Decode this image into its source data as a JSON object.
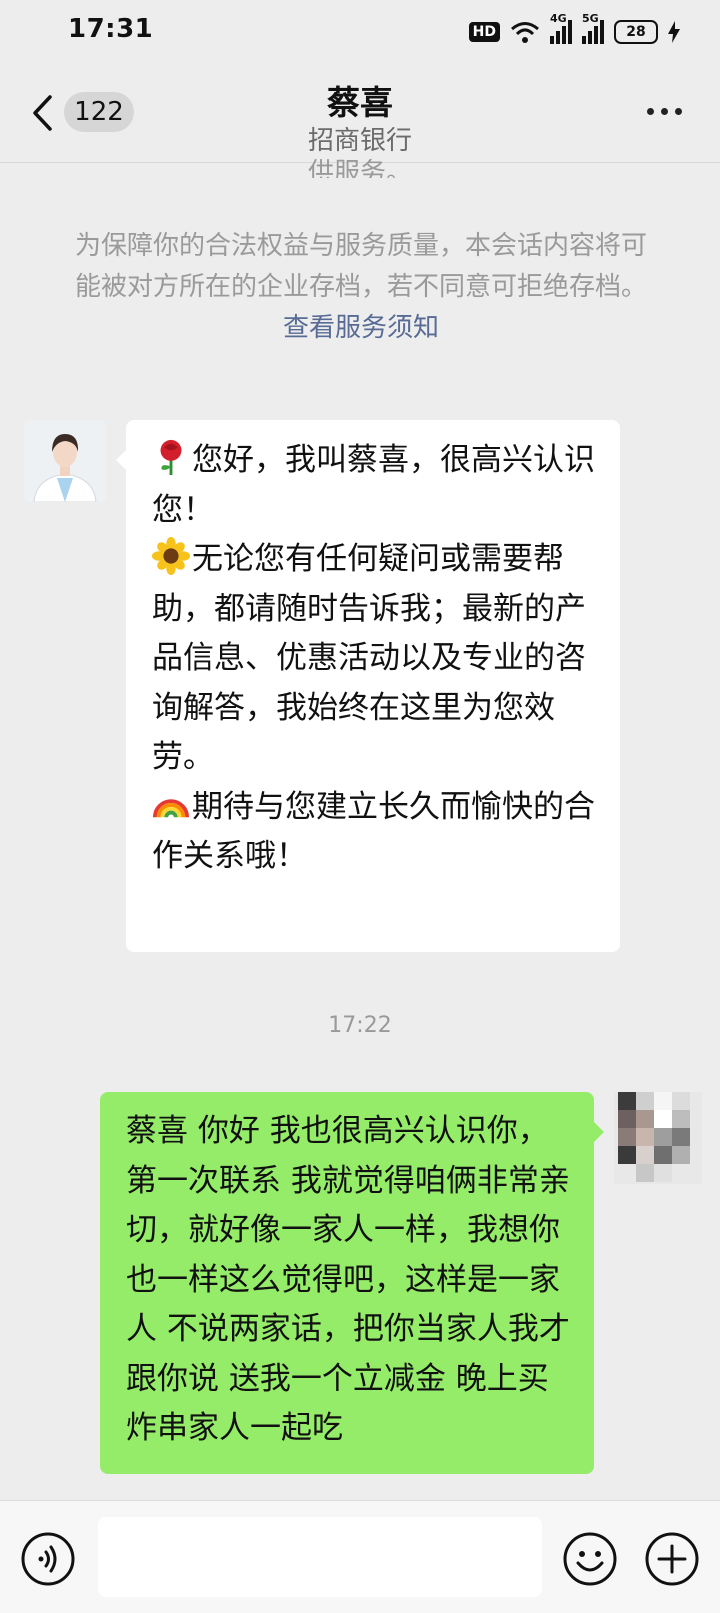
{
  "status_bar": {
    "time": "17:31",
    "hd": "HD",
    "net1": "4G",
    "net2": "5G",
    "battery": "28"
  },
  "header": {
    "back_badge": "122",
    "title": "蔡喜",
    "subtitle": "招商银行"
  },
  "chat": {
    "cutoff_text": "供服务。",
    "notice_text": "为保障你的合法权益与服务质量，本会话内容将可能被对方所在的企业存档，若不同意可拒绝存档。",
    "notice_link": "查看服务须知",
    "incoming": {
      "p1": "您好，我叫蔡喜，很高兴认识您！",
      "p2": "无论您有任何疑问或需要帮助，都请随时告诉我；最新的产品信息、优惠活动以及专业的咨询解答，我始终在这里为您效劳。",
      "p3": "期待与您建立长久而愉快的合作关系哦！"
    },
    "timestamp": "17:22",
    "outgoing": "蔡喜 你好 我也很高兴认识你，第一次联系 我就觉得咱俩非常亲切，就好像一家人一样，我想你也一样这么觉得吧，这样是一家人 不说两家话，把你当家人我才跟你说 送我一个立减金 晚上买炸串家人一起吃"
  },
  "icons": [
    "back-arrow-icon",
    "more-icon",
    "rose-emoji-icon",
    "sunflower-emoji-icon",
    "rainbow-emoji-icon",
    "voice-icon",
    "emoji-icon",
    "plus-icon"
  ],
  "colors": {
    "background": "#ededed",
    "outgoing_bubble": "#95ec69",
    "incoming_bubble": "#ffffff",
    "link": "#576b95"
  }
}
